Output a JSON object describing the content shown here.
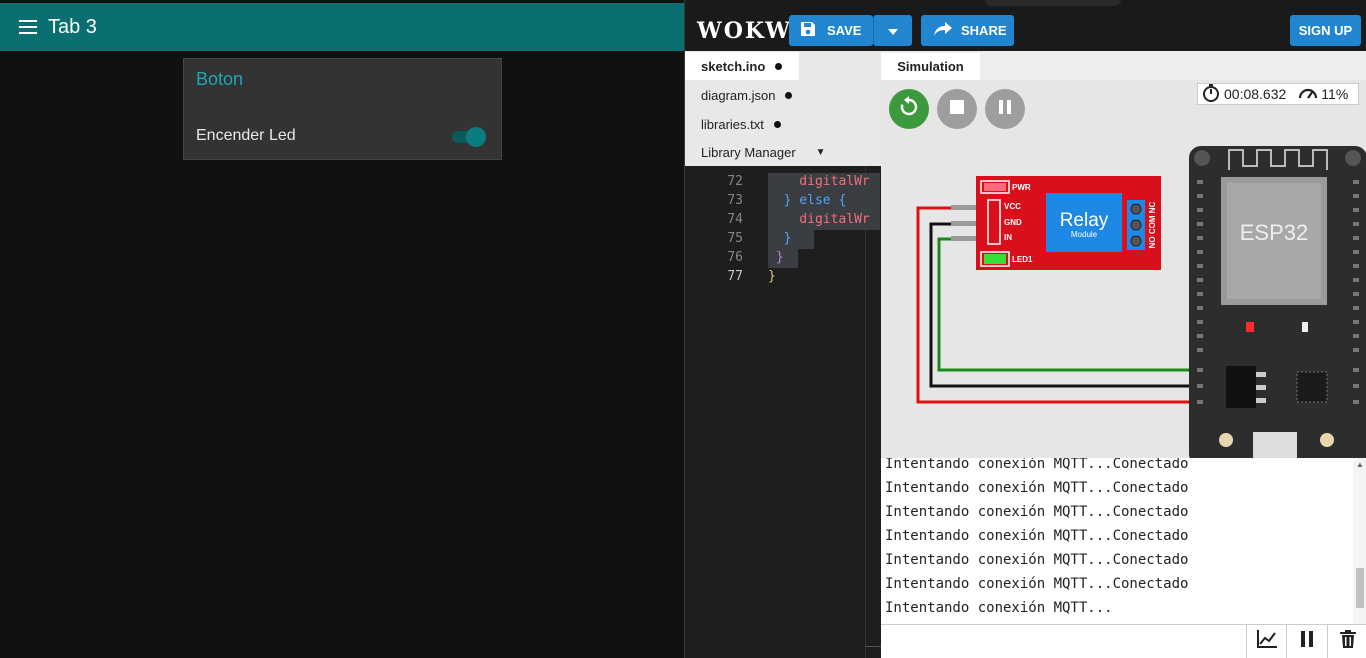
{
  "dashboard": {
    "header_title": "Tab 3",
    "card": {
      "title": "Boton",
      "switch_label": "Encender Led",
      "switch_state": "on"
    },
    "accent_color": "#0b6f72"
  },
  "wokwi": {
    "logo": "WOKWI",
    "toolbar": {
      "save_label": "SAVE",
      "share_label": "SHARE",
      "signup_label": "SIGN UP"
    },
    "files": [
      {
        "name": "sketch.ino",
        "active": true
      },
      {
        "name": "diagram.json",
        "active": false
      },
      {
        "name": "libraries.txt",
        "active": false
      }
    ],
    "library_manager_label": "Library Manager",
    "code_lines": [
      {
        "num": "72",
        "text": "    digitalWr"
      },
      {
        "num": "73",
        "text": "  } else {"
      },
      {
        "num": "74",
        "text": "    digitalWr"
      },
      {
        "num": "75",
        "text": "  }"
      },
      {
        "num": "76",
        "text": " }"
      },
      {
        "num": "77",
        "text": "}"
      }
    ],
    "simulation_tab": "Simulation",
    "timer": "00:08.632",
    "speed": "11%",
    "parts": {
      "relay_title": "Relay",
      "relay_sub": "Module",
      "relay_pins": [
        "PWR",
        "VCC",
        "GND",
        "IN",
        "LED1"
      ],
      "relay_terminals": "NO COM NC",
      "board_name": "ESP32"
    },
    "serial_lines": [
      "Intentando conexión MQTT...Conectado",
      "Intentando conexión MQTT...Conectado",
      "Intentando conexión MQTT...Conectado",
      "Intentando conexión MQTT...Conectado",
      "Intentando conexión MQTT...Conectado",
      "Intentando conexión MQTT...Conectado",
      "Intentando conexión MQTT..."
    ],
    "serial_input_placeholder": ""
  }
}
